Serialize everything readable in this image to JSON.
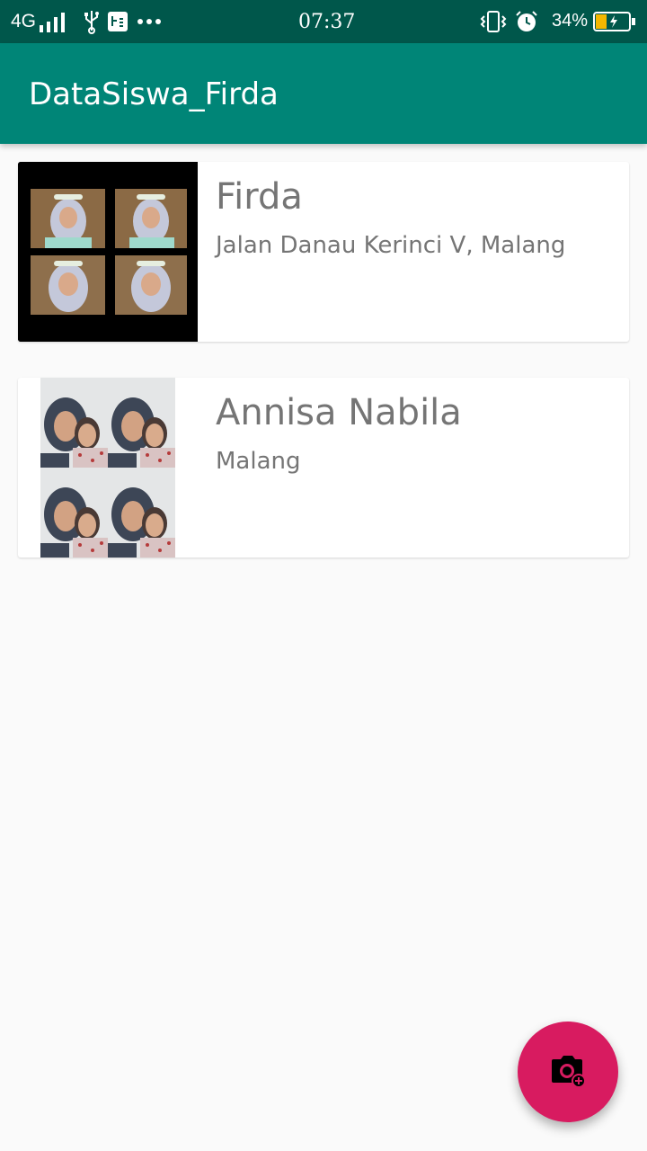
{
  "status_bar": {
    "network": "4G",
    "time": "07:37",
    "battery_percent": "34%",
    "battery_level": 0.34,
    "icons": [
      "signal-icon",
      "usb-icon",
      "notification-icon",
      "more-icon",
      "vibrate-icon",
      "alarm-icon",
      "battery-icon"
    ]
  },
  "app_bar": {
    "title": "DataSiswa_Firda"
  },
  "students": [
    {
      "name": "Firda",
      "address": "Jalan Danau Kerinci V, Malang"
    },
    {
      "name": "Annisa Nabila",
      "address": "Malang"
    }
  ],
  "fab": {
    "icon": "camera-add-icon"
  },
  "colors": {
    "status_bar": "#00574b",
    "app_bar": "#008577",
    "accent": "#d81b60",
    "text_secondary": "#757575"
  }
}
